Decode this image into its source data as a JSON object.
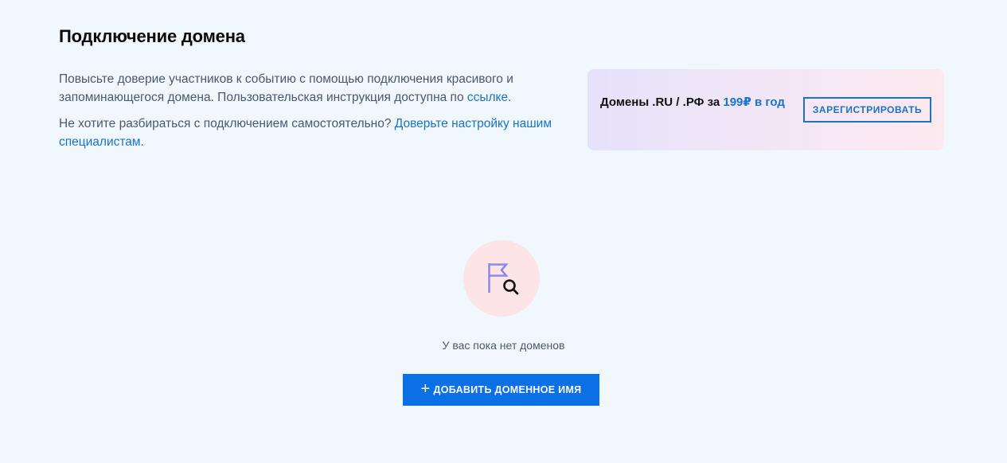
{
  "header": {
    "title": "Подключение домена"
  },
  "intro": {
    "p1_text": "Повысьте доверие участников к событию с помощью подключения красивого и запоминающегося домена. Пользовательская инструкция доступна по ",
    "p1_link": "ссылке",
    "p1_end": ".",
    "p2_text": "Не хотите разбираться с подключением самостоятельно? ",
    "p2_link": "Доверьте настройку нашим специалистам",
    "p2_end": "."
  },
  "promo": {
    "text_prefix": "Домены .RU / .РФ за ",
    "price": "199₽ в год",
    "button_label": "ЗАРЕГИСТРИРОВАТЬ"
  },
  "empty_state": {
    "icon": "flag-search-icon",
    "message": "У вас пока нет доменов",
    "add_button_label": "ДОБАВИТЬ ДОМЕННОЕ ИМЯ",
    "add_button_icon": "+"
  },
  "colors": {
    "background": "#f0f7fd",
    "accent": "#0b6fe6",
    "link": "#1a73c9",
    "illustration_bg": "#fde4e6",
    "flag": "#8c86f0"
  }
}
